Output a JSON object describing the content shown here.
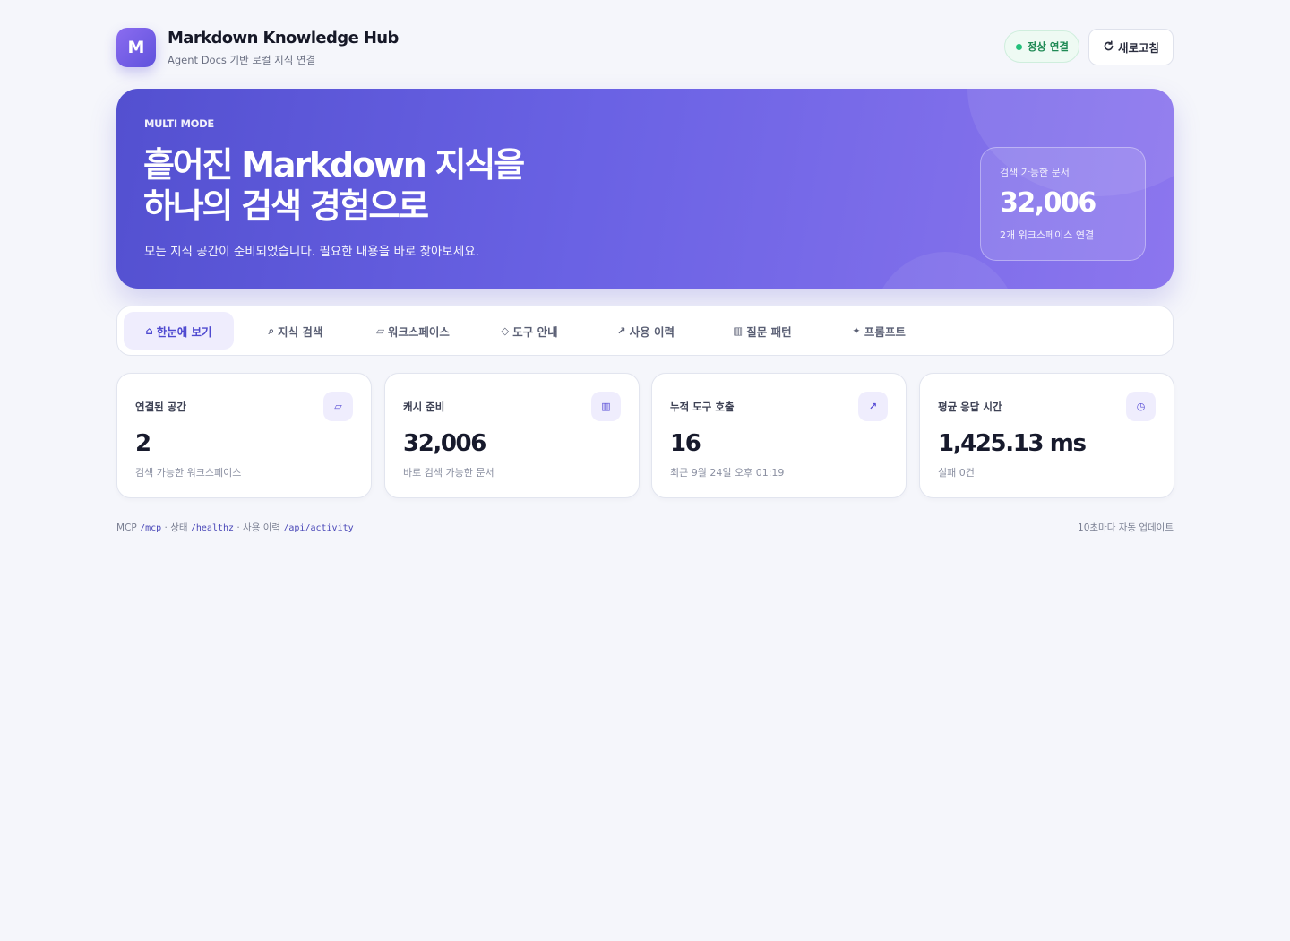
{
  "header": {
    "logo_letter": "M",
    "title": "Markdown Knowledge Hub",
    "subtitle": "Agent Docs 기반 로컬 지식 연결",
    "status_label": "정상 연결",
    "refresh_label": "새로고침"
  },
  "hero": {
    "eyebrow": "MULTI MODE",
    "title_line1": "흩어진 Markdown 지식을",
    "title_line2": "하나의 검색 경험으로",
    "description": "모든 지식 공간이 준비되었습니다. 필요한 내용을 바로 찾아보세요.",
    "stat": {
      "label": "검색 가능한 문서",
      "value": "32,006",
      "sub": "2개 워크스페이스 연결"
    }
  },
  "tabs": [
    {
      "icon": "⌂",
      "label": "한눈에 보기",
      "active": true
    },
    {
      "icon": "⌕",
      "label": "지식 검색"
    },
    {
      "icon": "▱",
      "label": "워크스페이스"
    },
    {
      "icon": "◇",
      "label": "도구 안내"
    },
    {
      "icon": "↗",
      "label": "사용 이력"
    },
    {
      "icon": "▥",
      "label": "질문 패턴"
    },
    {
      "icon": "✦",
      "label": "프롬프트"
    }
  ],
  "cards": [
    {
      "label": "연결된 공간",
      "icon": "▱",
      "value": "2",
      "sub": "검색 가능한 워크스페이스"
    },
    {
      "label": "캐시 준비",
      "icon": "▥",
      "value": "32,006",
      "sub": "바로 검색 가능한 문서"
    },
    {
      "label": "누적 도구 호출",
      "icon": "↗",
      "value": "16",
      "sub": "최근 9월 24일 오후 01:19"
    },
    {
      "label": "평균 응답 시간",
      "icon": "◷",
      "value": "1,425.13 ms",
      "sub": "실패 0건"
    }
  ],
  "footer": {
    "mcp_prefix": "MCP",
    "mcp_path": "/mcp",
    "status_prefix": "· 상태",
    "status_path": "/healthz",
    "activity_prefix": "· 사용 이력",
    "activity_path": "/api/activity",
    "auto_update": "10초마다 자동 업데이트"
  },
  "colors": {
    "accent": "#5f52dc",
    "status_green": "#22c07a",
    "background": "#f5f6fb"
  }
}
